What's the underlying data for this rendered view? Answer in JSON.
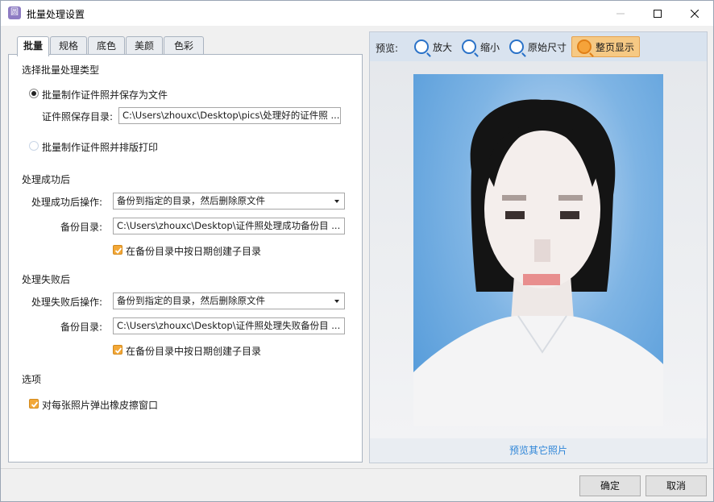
{
  "window": {
    "title": "批量处理设置",
    "app_icon_glyph": "圆"
  },
  "tabs": [
    "批量",
    "规格",
    "底色",
    "美颜",
    "色彩"
  ],
  "batch": {
    "section_type_heading": "选择批量处理类型",
    "option_save_file": "批量制作证件照并保存为文件",
    "save_dir_label": "证件照保存目录:",
    "save_dir_value": "C:\\Users\\zhouxc\\Desktop\\pics\\处理好的证件照 ...",
    "option_print": "批量制作证件照并排版打印",
    "success_heading": "处理成功后",
    "success_op_label": "处理成功后操作:",
    "success_op_value": "备份到指定的目录，然后删除原文件",
    "success_backup_label": "备份目录:",
    "success_backup_value": "C:\\Users\\zhouxc\\Desktop\\证件照处理成功备份目 ...",
    "success_date_subdir": "在备份目录中按日期创建子目录",
    "fail_heading": "处理失败后",
    "fail_op_label": "处理失败后操作:",
    "fail_op_value": "备份到指定的目录，然后删除原文件",
    "fail_backup_label": "备份目录:",
    "fail_backup_value": "C:\\Users\\zhouxc\\Desktop\\证件照处理失败备份目 ...",
    "fail_date_subdir": "在备份目录中按日期创建子目录",
    "options_heading": "选项",
    "option_eraser_popup": "对每张照片弹出橡皮擦窗口"
  },
  "preview": {
    "label": "预览:",
    "zoom_in": "放大",
    "zoom_out": "缩小",
    "original_size": "原始尺寸",
    "fit_page": "整页显示",
    "preview_other": "预览其它照片"
  },
  "buttons": {
    "ok": "确定",
    "cancel": "取消"
  },
  "colors": {
    "accent": "#f3a838",
    "link": "#2f86d8",
    "photo_bg": "#4e97d8"
  }
}
